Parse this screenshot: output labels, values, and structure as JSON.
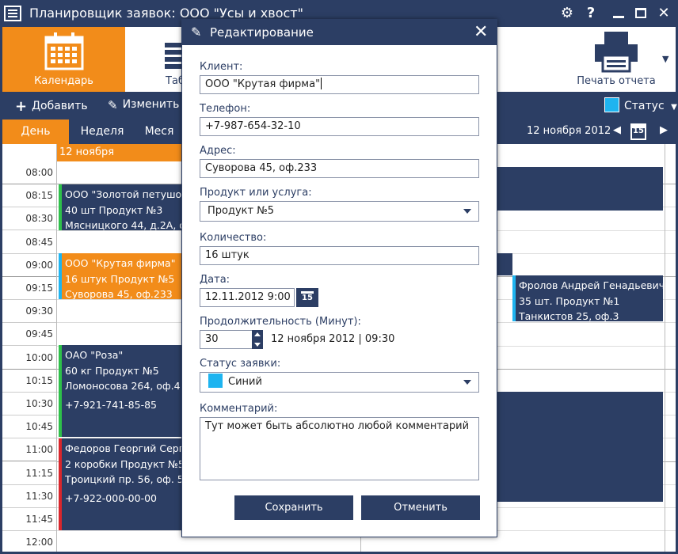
{
  "window": {
    "title": "Планировщик заявок: ООО \"Усы и хвост\"",
    "settings_icon": "gear-icon",
    "help_label": "?"
  },
  "ribbon": {
    "calendar_label": "Календарь",
    "table_label": "Таб",
    "print_label": "Печать отчета"
  },
  "commands": {
    "add_label": "Добавить",
    "edit_label": "Изменить",
    "status_label": "Статус",
    "status_color": "#1eb4f0"
  },
  "views": {
    "tabs": [
      "День",
      "Неделя",
      "Меся"
    ],
    "current_date": "12 ноября 2012",
    "calendar_day": "15"
  },
  "calendar": {
    "day_header": "12 ноября",
    "times": [
      "08:00",
      "08:15",
      "08:30",
      "08:45",
      "09:00",
      "09:15",
      "09:30",
      "09:45",
      "10:00",
      "10:15",
      "10:30",
      "10:45",
      "11:00",
      "11:15",
      "11:30",
      "11:45",
      "12:00"
    ],
    "appointments": [
      {
        "lines": [
          "ООО \"Золотой петушок\"",
          "40 шт   Продукт №3",
          "Мясницкого 44, д.2А, оф"
        ],
        "accent": "#2ec04a",
        "color": "#2c3e64"
      },
      {
        "lines": [
          "ООО \"Крутая фирма\"",
          "16 штук   Продукт №5",
          "Суворова 45, оф.233"
        ],
        "accent": "#1eb4f0",
        "color": "#f28c1a"
      },
      {
        "lines": [
          "ОАО \"Роза\"",
          "60 кг   Продукт №5",
          "Ломоносова 264, оф.4",
          "",
          "+7-921-741-85-85"
        ],
        "accent": "#2ec04a",
        "color": "#2c3e64"
      },
      {
        "lines": [
          "Федоров Георгий Сергее",
          "2 коробки   Продукт №5",
          "Троицкий пр. 56, оф. 5",
          "",
          "+7-922-000-00-00"
        ],
        "accent": "#d9262c",
        "color": "#2c3e64"
      },
      {
        "lines": [
          "Фролов Андрей Генадьевич",
          "35 шт.   Продукт №1",
          "Танкистов 25, оф.3"
        ],
        "accent": "#1eb4f0",
        "color": "#2c3e64"
      }
    ]
  },
  "dialog": {
    "title": "Редактирование",
    "client_label": "Клиент:",
    "client_value": "ООО \"Крутая фирма\"",
    "phone_label": "Телефон:",
    "phone_value": "+7-987-654-32-10",
    "address_label": "Адрес:",
    "address_value": "Суворова 45, оф.233",
    "product_label": "Продукт или услуга:",
    "product_value": "Продукт №5",
    "quantity_label": "Количество:",
    "quantity_value": "16 штук",
    "date_label": "Дата:",
    "date_value": "12.11.2012 9:00",
    "date_button_day": "15",
    "duration_label": "Продолжительность (Минут):",
    "duration_value": "30",
    "duration_summary": "12 ноября 2012 | 09:30",
    "status_label": "Статус заявки:",
    "status_value": "Синий",
    "status_color": "#1eb4f0",
    "comment_label": "Комментарий:",
    "comment_value": "Тут может быть абсолютно любой комментарий",
    "save_label": "Сохранить",
    "cancel_label": "Отменить"
  }
}
